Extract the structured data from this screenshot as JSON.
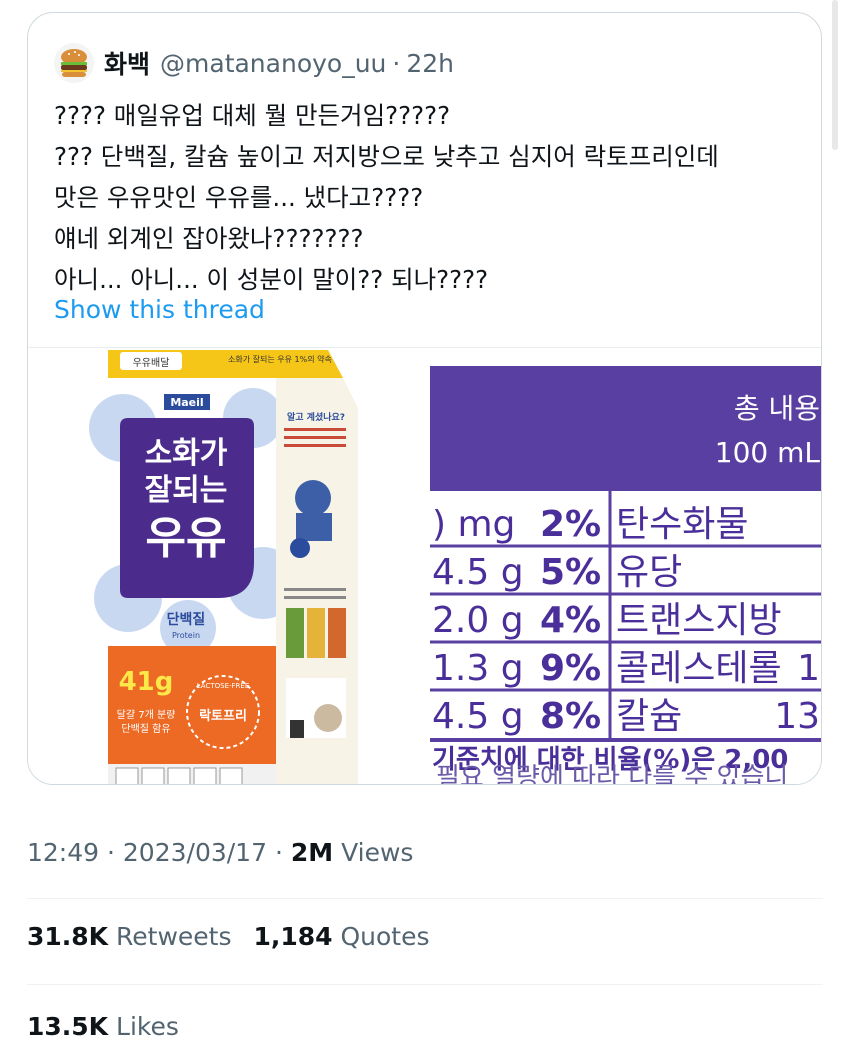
{
  "quote": {
    "display_name": "화백",
    "handle": "@matananoyo_uu",
    "separator": "·",
    "age": "22h",
    "avatar_icon": "burger-icon",
    "lines": [
      "???? 매일유업 대체 뭘 만든거임?????",
      "??? 단백질, 칼슘 높이고 저지방으로 낮추고 심지어 락토프리인데",
      "맛은 우유맛인 우유를... 냈다고????",
      "얘네 외계인 잡아왔나???????",
      "아니... 아니... 이 성분이 말이?? 되나????"
    ],
    "show_thread": "Show this thread"
  },
  "product": {
    "brand": "Maeil",
    "top_banner": "우유배달",
    "top_note": "소화가 잘되는 우유 1%의 약속",
    "name_line1": "소화가",
    "name_line2": "잘되는",
    "name_line3": "우유",
    "protein_ko": "단백질",
    "protein_en": "Protein",
    "protein_amount": "41g",
    "protein_note1": "달걀 7개 분량",
    "protein_note2": "단백질 함유",
    "lactose_free": "락토프리",
    "lactose_free_en": "LACTOSE-FREE",
    "side_heading": "알고 계셨나요?"
  },
  "nutrition": {
    "header1": "총 내용",
    "header2": "100 mL",
    "rows": [
      {
        "amount": ") mg",
        "pct": "2%",
        "name": "탄수화물",
        "extra": ""
      },
      {
        "amount": "4.5 g",
        "pct": "5%",
        "name": "유당",
        "extra": ""
      },
      {
        "amount": "2.0 g",
        "pct": "4%",
        "name": "트랜스지방",
        "extra": ""
      },
      {
        "amount": "1.3 g",
        "pct": "9%",
        "name": "콜레스테롤",
        "extra": "1"
      },
      {
        "amount": "4.5 g",
        "pct": "8%",
        "name": "칼슘",
        "extra": "13"
      }
    ],
    "footer1": "기준치에 대한 비율(%)은 2,00",
    "footer2": "필요 열량에 따라 다를 수 있습니"
  },
  "meta": {
    "time": "12:49",
    "date": "2023/03/17",
    "dot": "·",
    "views_count": "2M",
    "views_label": "Views"
  },
  "stats": {
    "retweets_count": "31.8K",
    "retweets_label": "Retweets",
    "quotes_count": "1,184",
    "quotes_label": "Quotes",
    "likes_count": "13.5K",
    "likes_label": "Likes"
  },
  "colors": {
    "link": "#1d9bf0",
    "label_purple": "#5a3fa3",
    "carton_purple": "#4b2c8c",
    "carton_orange": "#ec6a24"
  }
}
